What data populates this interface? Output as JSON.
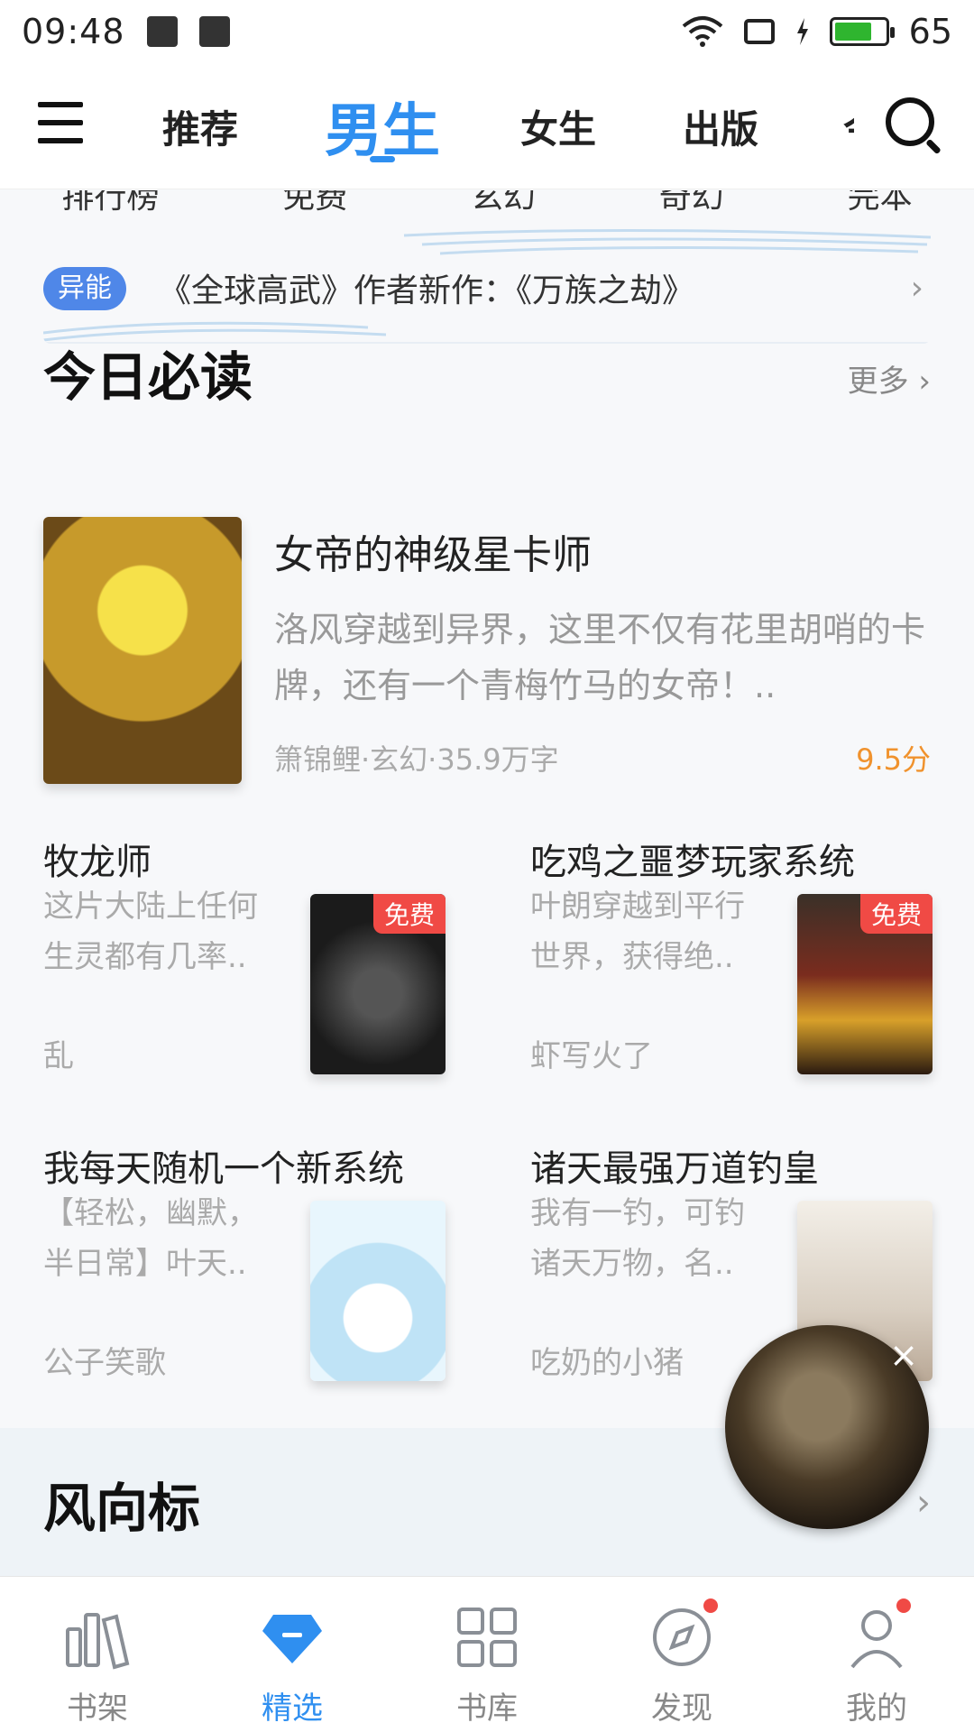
{
  "status": {
    "time": "09:48",
    "battery": "65"
  },
  "nav": {
    "tabs": [
      {
        "label": "推荐"
      },
      {
        "label": "男生"
      },
      {
        "label": "女生"
      },
      {
        "label": "出版"
      }
    ],
    "cut_tab": "今"
  },
  "categories": [
    "排行榜",
    "免费",
    "玄幻",
    "奇幻",
    "完本"
  ],
  "banner": {
    "tag": "异能",
    "text": "《全球高武》作者新作：《万族之劫》"
  },
  "today": {
    "title": "今日必读",
    "more": "更多",
    "featured": {
      "title": "女帝的神级星卡师",
      "desc": "洛风穿越到异界，这里不仅有花里胡哨的卡牌，还有一个青梅竹马的女帝！..",
      "meta": "箫锦鲤·玄幻·35.9万字",
      "score": "9.5分"
    },
    "books": [
      {
        "title": "牧龙师",
        "desc": "这片大陆上任何生灵都有几率..",
        "author": "乱",
        "badge": "免费"
      },
      {
        "title": "吃鸡之噩梦玩家系统",
        "desc": "叶朗穿越到平行世界，获得绝..",
        "author": "虾写火了",
        "badge": "免费"
      },
      {
        "title": "我每天随机一个新系统",
        "desc": "【轻松，幽默，半日常】叶天..",
        "author": "公子笑歌",
        "badge": ""
      },
      {
        "title": "诸天最强万道钓皇",
        "desc": "我有一钓，可钓诸天万物，名..",
        "author": "吃奶的小猪",
        "badge": ""
      }
    ]
  },
  "wind": {
    "title": "风向标"
  },
  "tabbar": [
    {
      "label": "书架",
      "icon": "bookshelf-icon"
    },
    {
      "label": "精选",
      "icon": "diamond-icon"
    },
    {
      "label": "书库",
      "icon": "grid-icon"
    },
    {
      "label": "发现",
      "icon": "compass-icon"
    },
    {
      "label": "我的",
      "icon": "user-icon"
    }
  ],
  "colors": {
    "accent": "#2f8ff0",
    "score": "#f0922d",
    "badge": "#f04a45",
    "tag": "#4f87e8"
  }
}
